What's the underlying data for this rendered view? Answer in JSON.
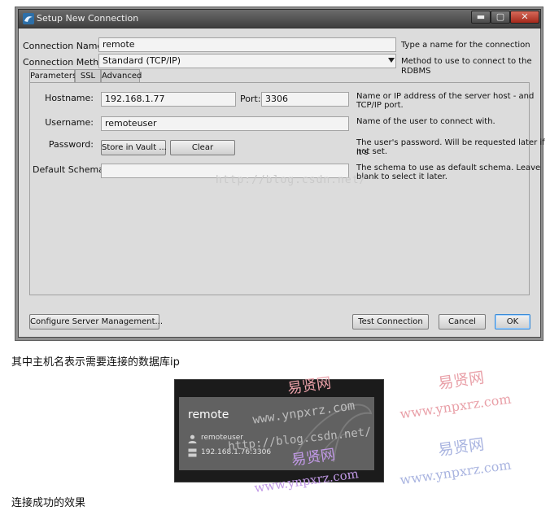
{
  "window": {
    "title": "Setup New Connection",
    "min_glyph": "▬",
    "max_glyph": "▢",
    "close_glyph": "✕"
  },
  "form": {
    "connection_name_label": "Connection Name:",
    "connection_name_value": "remote",
    "connection_name_hint": "Type a name for the connection",
    "connection_method_label": "Connection Method:",
    "connection_method_value": "Standard (TCP/IP)",
    "connection_method_hint": "Method to use to connect to the RDBMS"
  },
  "tabs": [
    {
      "label": "Parameters",
      "active": true
    },
    {
      "label": "SSL",
      "active": false
    },
    {
      "label": "Advanced",
      "active": false
    }
  ],
  "parameters": {
    "hostname_label": "Hostname:",
    "hostname_value": "192.168.1.77",
    "port_label": "Port:",
    "port_value": "3306",
    "hostname_hint_1": "Name or IP address of the server host - and",
    "hostname_hint_2": "TCP/IP port.",
    "username_label": "Username:",
    "username_value": "remoteuser",
    "username_hint": "Name of the user to connect with.",
    "password_label": "Password:",
    "store_in_vault_label": "Store in Vault ...",
    "clear_label": "Clear",
    "password_hint_1": "The user's password. Will be requested later if it's",
    "password_hint_2": "not set.",
    "default_schema_label": "Default Schema:",
    "default_schema_value": "",
    "default_schema_hint_1": "The schema to use as default schema. Leave",
    "default_schema_hint_2": "blank to select it later."
  },
  "footer": {
    "configure_label": "Configure Server Management...",
    "test_label": "Test Connection",
    "cancel_label": "Cancel",
    "ok_label": "OK"
  },
  "captions": {
    "hostname_note": "其中主机名表示需要连接的数据库ip",
    "success_note": "连接成功的效果"
  },
  "tile": {
    "name": "remote",
    "user": "remoteuser",
    "host": "192.168.1.76:3306"
  },
  "watermarks": {
    "blog_url": "http://blog.csdn.net/",
    "site_cn": "易贤网",
    "site_url": "www.ynpxrz.com"
  },
  "colors": {
    "titlebar": "#4f4f4f",
    "dialog_bg": "#dcdcdc",
    "ok_focus": "#3b8bd6",
    "tile_bg": "#616161",
    "tile_frame": "#1b1b1b"
  }
}
